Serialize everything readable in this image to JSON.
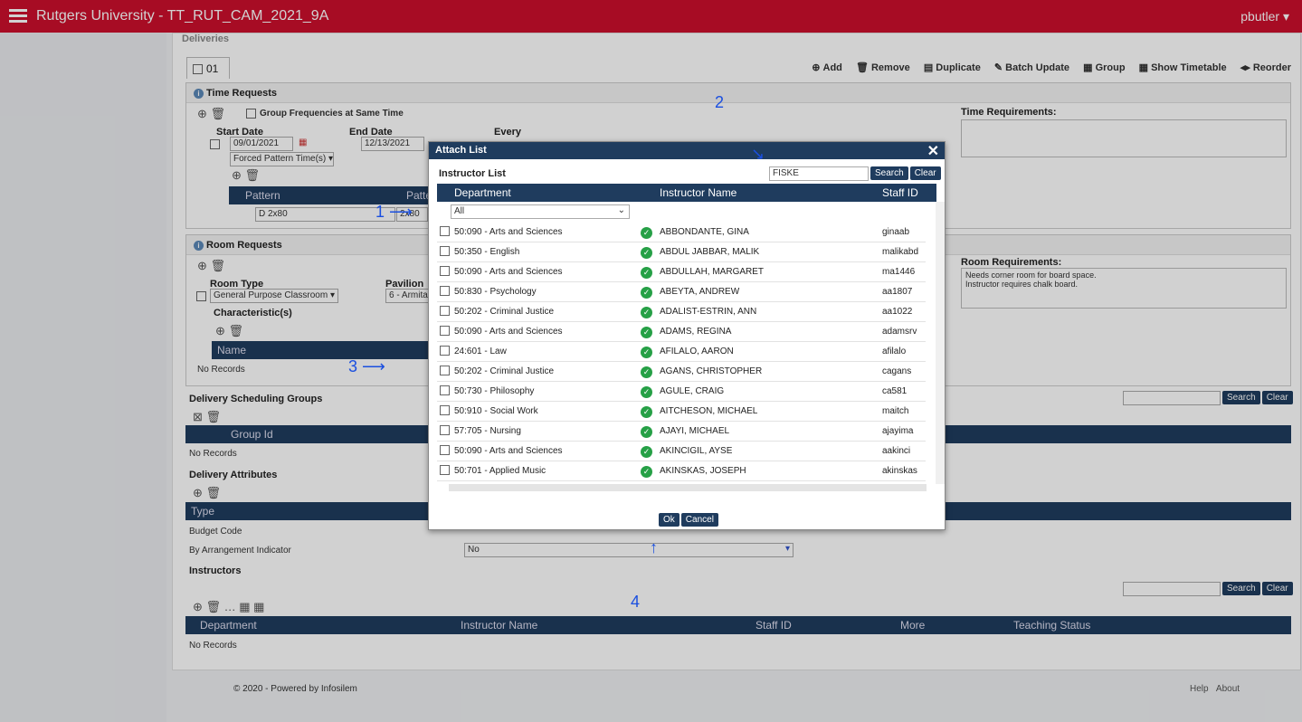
{
  "app": {
    "title": "Rutgers University - TT_RUT_CAM_2021_9A",
    "user": "pbutler"
  },
  "deliveries": {
    "label": "Deliveries",
    "tab": "01"
  },
  "toolbar": {
    "add": "Add",
    "remove": "Remove",
    "duplicate": "Duplicate",
    "batch_update": "Batch Update",
    "group": "Group",
    "show_timetable": "Show Timetable",
    "reorder": "Reorder"
  },
  "time_requests": {
    "title": "Time Requests",
    "group_freq": "Group Frequencies at Same Time",
    "start_date_label": "Start Date",
    "start_date": "09/01/2021",
    "end_date_label": "End Date",
    "end_date": "12/13/2021",
    "every_label": "Every",
    "pattern_mode": "Forced Pattern Time(s)",
    "pattern_col": "Pattern",
    "pattern_col2": "Patte",
    "pattern_value": "D 2x80",
    "pattern_value2": "2x80",
    "requirements_label": "Time Requirements:"
  },
  "room_requests": {
    "title": "Room Requests",
    "room_type_label": "Room Type",
    "room_type": "General Purpose Classroom",
    "pavilion_label": "Pavilion",
    "pavilion": "6 - Armitag",
    "characteristics_label": "Characteristic(s)",
    "name_col": "Name",
    "no_records": "No Records",
    "requirements_label": "Room Requirements:",
    "requirements_text": "Needs corner room for board space.\nInstructor requires chalk board."
  },
  "scheduling_groups": {
    "title": "Delivery Scheduling Groups",
    "group_col": "Group Id",
    "no_records": "No Records",
    "search": "Search",
    "clear": "Clear"
  },
  "attributes": {
    "title": "Delivery Attributes",
    "type_col": "Type",
    "budget_code": "Budget Code",
    "by_arrangement": "By Arrangement Indicator",
    "by_arrangement_value": "No"
  },
  "instructors": {
    "title": "Instructors",
    "search": "Search",
    "clear": "Clear",
    "cols": [
      "Department",
      "Instructor Name",
      "Staff ID",
      "More",
      "Teaching Status"
    ],
    "no_records": "No Records"
  },
  "dialog": {
    "title": "Attach List",
    "close": "✕",
    "list_label": "Instructor List",
    "search_value": "FISKE",
    "search": "Search",
    "clear": "Clear",
    "dept_col": "Department",
    "name_col": "Instructor Name",
    "staff_col": "Staff ID",
    "filter": "All",
    "ok": "Ok",
    "cancel": "Cancel",
    "rows": [
      {
        "dept": "50:090 - Arts and Sciences",
        "name": "ABBONDANTE, GINA",
        "staff": "ginaab"
      },
      {
        "dept": "50:350 - English",
        "name": "ABDUL JABBAR, MALIK",
        "staff": "malikabd"
      },
      {
        "dept": "50:090 - Arts and Sciences",
        "name": "ABDULLAH, MARGARET",
        "staff": "ma1446"
      },
      {
        "dept": "50:830 - Psychology",
        "name": "ABEYTA, ANDREW",
        "staff": "aa1807"
      },
      {
        "dept": "50:202 - Criminal Justice",
        "name": "ADALIST-ESTRIN, ANN",
        "staff": "aa1022"
      },
      {
        "dept": "50:090 - Arts and Sciences",
        "name": "ADAMS, REGINA",
        "staff": "adamsrv"
      },
      {
        "dept": "24:601 - Law",
        "name": "AFILALO, AARON",
        "staff": "afilalo"
      },
      {
        "dept": "50:202 - Criminal Justice",
        "name": "AGANS, CHRISTOPHER",
        "staff": "cagans"
      },
      {
        "dept": "50:730 - Philosophy",
        "name": "AGULE, CRAIG",
        "staff": "ca581"
      },
      {
        "dept": "50:910 - Social Work",
        "name": "AITCHESON, MICHAEL",
        "staff": "maitch"
      },
      {
        "dept": "57:705 - Nursing",
        "name": "AJAYI, MICHAEL",
        "staff": "ajayima"
      },
      {
        "dept": "50:090 - Arts and Sciences",
        "name": "AKINCIGIL, AYSE",
        "staff": "aakinci"
      },
      {
        "dept": "50:701 - Applied Music",
        "name": "AKINSKAS, JOSEPH",
        "staff": "akinskas"
      }
    ]
  },
  "annotations": {
    "a1": "1",
    "a2": "2",
    "a3": "3",
    "a4": "4"
  },
  "footer": {
    "copyright": "© 2020 - Powered by Infosilem",
    "help": "Help",
    "about": "About"
  }
}
